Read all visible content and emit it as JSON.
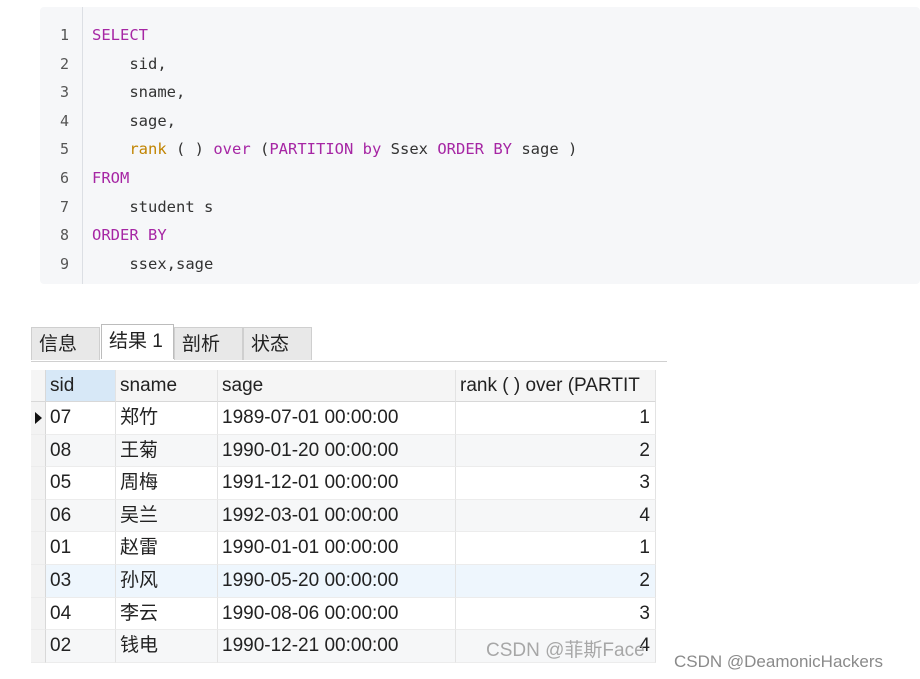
{
  "code": {
    "line_numbers": [
      "1",
      "2",
      "3",
      "4",
      "5",
      "6",
      "7",
      "8",
      "9"
    ],
    "lines": [
      [
        {
          "t": "SELECT",
          "k": "kw"
        }
      ],
      [
        {
          "t": "    sid,",
          "k": ""
        }
      ],
      [
        {
          "t": "    sname,",
          "k": ""
        }
      ],
      [
        {
          "t": "    sage,",
          "k": ""
        }
      ],
      [
        {
          "t": "    ",
          "k": ""
        },
        {
          "t": "rank",
          "k": "fn"
        },
        {
          "t": " ( ) ",
          "k": ""
        },
        {
          "t": "over",
          "k": "kw"
        },
        {
          "t": " (",
          "k": ""
        },
        {
          "t": "PARTITION",
          "k": "kw"
        },
        {
          "t": " ",
          "k": ""
        },
        {
          "t": "by",
          "k": "kw"
        },
        {
          "t": " Ssex ",
          "k": ""
        },
        {
          "t": "ORDER BY",
          "k": "kw"
        },
        {
          "t": " sage )",
          "k": ""
        }
      ],
      [
        {
          "t": "FROM",
          "k": "kw"
        }
      ],
      [
        {
          "t": "    student s",
          "k": ""
        }
      ],
      [
        {
          "t": "ORDER BY",
          "k": "kw"
        }
      ],
      [
        {
          "t": "    ssex,sage",
          "k": ""
        }
      ]
    ]
  },
  "tabs": [
    {
      "label": "信息",
      "active": false
    },
    {
      "label": "结果 1",
      "active": true
    },
    {
      "label": "剖析",
      "active": false
    },
    {
      "label": "状态",
      "active": false
    }
  ],
  "grid": {
    "columns": [
      "sid",
      "sname",
      "sage",
      "rank ( ) over (PARTIT"
    ],
    "rows": [
      [
        "07",
        "郑竹",
        "1989-07-01 00:00:00",
        "1"
      ],
      [
        "08",
        "王菊",
        "1990-01-20 00:00:00",
        "2"
      ],
      [
        "05",
        "周梅",
        "1991-12-01 00:00:00",
        "3"
      ],
      [
        "06",
        "吴兰",
        "1992-03-01 00:00:00",
        "4"
      ],
      [
        "01",
        "赵雷",
        "1990-01-01 00:00:00",
        "1"
      ],
      [
        "03",
        "孙风",
        "1990-05-20 00:00:00",
        "2"
      ],
      [
        "04",
        "李云",
        "1990-08-06 00:00:00",
        "3"
      ],
      [
        "02",
        "钱电",
        "1990-12-21 00:00:00",
        "4"
      ]
    ],
    "current_row": 0,
    "highlight_row": 5
  },
  "watermarks": {
    "inner": "CSDN @菲斯Face",
    "outer": "CSDN @DeamonicHackers"
  },
  "colors": {
    "keyword": "#a626a4",
    "function": "#c18401",
    "selected_header": "#d7e8f7"
  }
}
